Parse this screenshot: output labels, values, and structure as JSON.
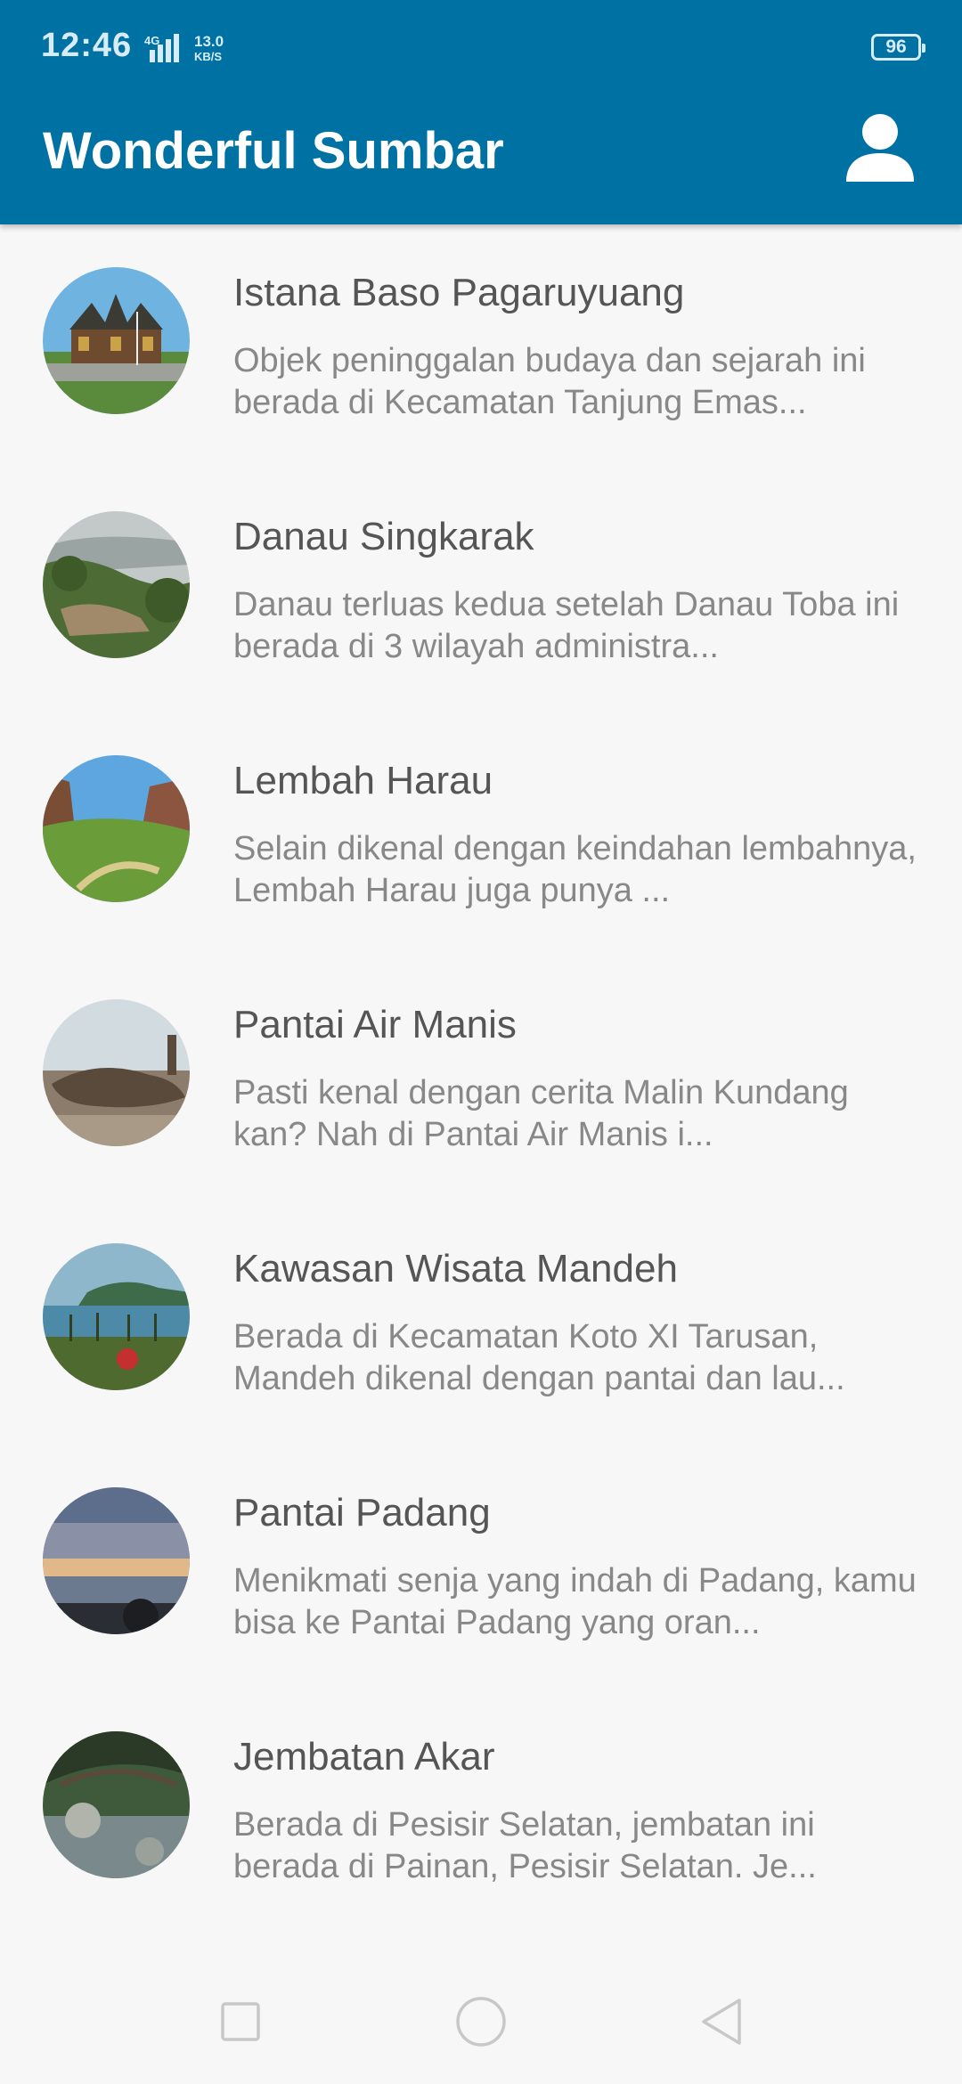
{
  "status_bar": {
    "time": "12:46",
    "network": "4G",
    "speed_value": "13.0",
    "speed_unit": "KB/S",
    "battery": "96"
  },
  "app_bar": {
    "title": "Wonderful Sumbar",
    "profile_icon": "person-icon"
  },
  "places": [
    {
      "name": "Istana Baso Pagaruyuang",
      "description": "Objek peninggalan budaya dan sejarah ini berada di Kecamatan Tanjung Emas..."
    },
    {
      "name": "Danau Singkarak",
      "description": "Danau terluas kedua setelah Danau Toba ini berada di 3 wilayah administra..."
    },
    {
      "name": "Lembah Harau",
      "description": "Selain dikenal dengan keindahan lembahnya, Lembah Harau juga punya ..."
    },
    {
      "name": "Pantai Air Manis",
      "description": "Pasti kenal dengan cerita Malin Kundang kan? Nah di Pantai Air Manis i..."
    },
    {
      "name": "Kawasan Wisata Mandeh",
      "description": "Berada di Kecamatan Koto XI Tarusan, Mandeh dikenal dengan pantai dan lau..."
    },
    {
      "name": "Pantai Padang",
      "description": "Menikmati senja yang indah di Padang, kamu bisa ke Pantai Padang yang oran..."
    },
    {
      "name": "Jembatan Akar",
      "description": "Berada di Pesisir Selatan, jembatan ini berada di Painan, Pesisir Selatan. Je..."
    }
  ],
  "nav_bar": {
    "recent_icon": "square-icon",
    "home_icon": "circle-icon",
    "back_icon": "triangle-back-icon"
  },
  "colors": {
    "app_bar": "#0071a3",
    "background": "#f7f7f7",
    "title_text": "#555555",
    "desc_text": "#888888"
  }
}
